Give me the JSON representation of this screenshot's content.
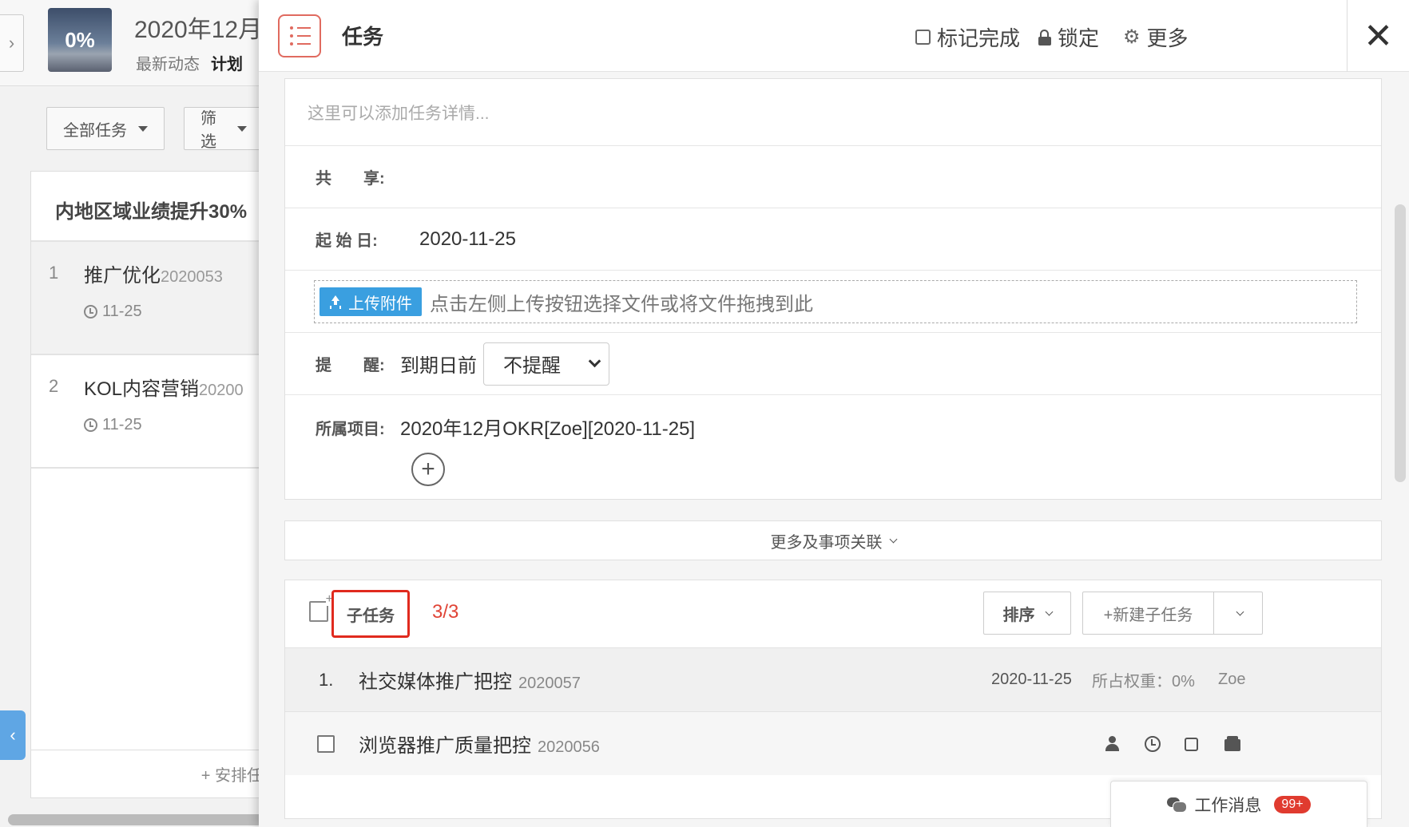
{
  "background_page": {
    "progress": "0%",
    "project_title": "2020年12月",
    "tabs": [
      "最新动态",
      "计划"
    ],
    "filters": {
      "all_tasks": "全部任务",
      "filter": "筛选"
    },
    "panel_title": "内地区域业绩提升30%",
    "tasks": [
      {
        "num": "1",
        "name": "推广优化",
        "code": "2020053",
        "due": "11-25"
      },
      {
        "num": "2",
        "name": "KOL内容营销",
        "code": "20200",
        "due": "11-25"
      }
    ],
    "arrange": "+ 安排任"
  },
  "drawer": {
    "title": "任务",
    "actions": {
      "mark_done": "标记完成",
      "lock": "锁定",
      "more": "更多"
    },
    "details": {
      "placeholder": "这里可以添加任务详情...",
      "share_label": "共　　享:",
      "start_label": "起 始 日:",
      "start_value": "2020-11-25",
      "upload_button": "上传附件",
      "upload_hint": "点击左侧上传按钮选择文件或将文件拖拽到此",
      "reminder_label": "提　　醒:",
      "reminder_prefix": "到期日前",
      "reminder_option": "不提醒",
      "project_label": "所属项目:",
      "project_value": "2020年12月OKR[Zoe][2020-11-25]"
    },
    "more_link": "更多及事项关联",
    "subtasks": {
      "tab_label": "子任务",
      "count": "3/3",
      "sort_label": "排序",
      "new_label": "+新建子任务",
      "rows": [
        {
          "num": "1.",
          "name": "社交媒体推广把控",
          "code": "2020057",
          "date": "2020-11-25",
          "weight": "所占权重：0%",
          "owner": "Zoe"
        },
        {
          "name": "浏览器推广质量把控",
          "code": "2020056"
        }
      ]
    }
  },
  "work_message": {
    "label": "工作消息",
    "badge": "99+"
  }
}
